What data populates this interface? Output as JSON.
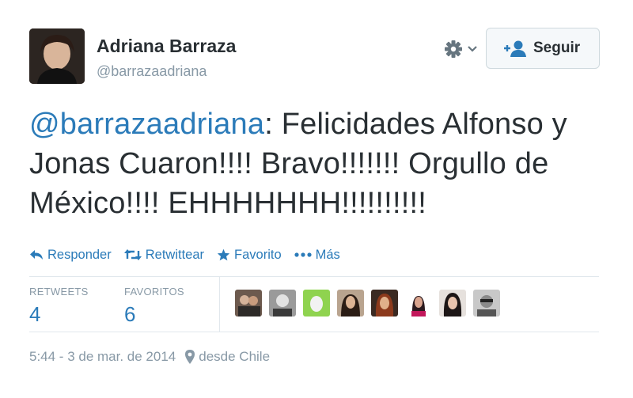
{
  "user": {
    "name": "Adriana Barraza",
    "handle": "@barrazaadriana"
  },
  "follow_button": {
    "label": "Seguir"
  },
  "tweet": {
    "mention": "@barrazaadriana",
    "text": ": Felicidades Alfonso y Jonas Cuaron!!!! Bravo!!!!!!! Orgullo de México!!!! EHHHHHHH!!!!!!!!!!"
  },
  "actions": [
    {
      "label": "Responder",
      "icon": "reply-icon"
    },
    {
      "label": "Retwittear",
      "icon": "retweet-icon"
    },
    {
      "label": "Favorito",
      "icon": "star-icon"
    },
    {
      "label": "Más",
      "icon": "more-icon"
    }
  ],
  "stats": {
    "retweets_label": "RETWEETS",
    "retweets_value": "4",
    "favoritos_label": "FAVORITOS",
    "favoritos_value": "6"
  },
  "meta": {
    "timestamp": "5:44 - 3 de mar. de 2014",
    "location": "desde Chile"
  },
  "colors": {
    "link": "#2b7bb9",
    "text": "#292f33",
    "muted": "#8899a6",
    "divider": "#e1e8ed"
  }
}
